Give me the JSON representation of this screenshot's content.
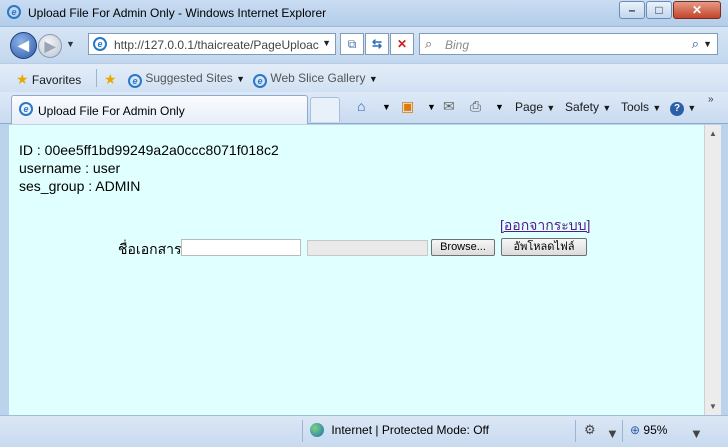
{
  "window": {
    "title": "Upload File For Admin Only - Windows Internet Explorer"
  },
  "navigation": {
    "url": "http://127.0.0.1/thaicreate/PageUploac",
    "search_placeholder": "Bing"
  },
  "favorites_bar": {
    "favorites_label": "Favorites",
    "suggested_sites_label": "Suggested Sites",
    "web_slice_label": "Web Slice Gallery"
  },
  "tab": {
    "label": "Upload File For Admin Only"
  },
  "command_bar": {
    "page_label": "Page",
    "safety_label": "Safety",
    "tools_label": "Tools"
  },
  "content": {
    "id_line": "ID : 00ee5ff1bd99249a2a0ccc8071f018c2",
    "username_line": "username : user",
    "group_line": "ses_group : ADMIN",
    "logout_link": "[ออกจากระบบ]",
    "doc_name_label": "ชื่อเอกสาร",
    "doc_name_value": "",
    "browse_label": "Browse...",
    "upload_label": "อัพโหลดไฟล์"
  },
  "status_bar": {
    "zone_text": "Internet | Protected Mode: Off",
    "zoom": "95%"
  },
  "colors": {
    "content_background": "#e0ffff",
    "link_visited": "#551a8b"
  }
}
